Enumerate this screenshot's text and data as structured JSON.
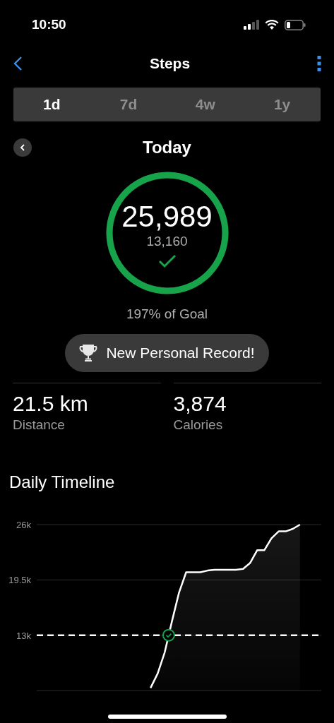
{
  "status_bar": {
    "time": "10:50"
  },
  "nav": {
    "title": "Steps"
  },
  "tabs": [
    {
      "label": "1d",
      "selected": true
    },
    {
      "label": "7d",
      "selected": false
    },
    {
      "label": "4w",
      "selected": false
    },
    {
      "label": "1y",
      "selected": false
    }
  ],
  "period": {
    "title": "Today"
  },
  "ring": {
    "steps": "25,989",
    "goal": "13,160",
    "level": 1,
    "goal_met": true,
    "caption": "197% of Goal"
  },
  "badge": {
    "label": "New Personal Record!"
  },
  "stats": [
    {
      "value": "21.5 km",
      "label": "Distance"
    },
    {
      "value": "3,874",
      "label": "Calories"
    }
  ],
  "timeline": {
    "title": "Daily Timeline",
    "chart_data": {
      "type": "area",
      "ylim": [
        6500,
        26000
      ],
      "yticks": [
        {
          "value": 26000,
          "label": "26k"
        },
        {
          "value": 19500,
          "label": "19.5k"
        },
        {
          "value": 13000,
          "label": "13k"
        }
      ],
      "categories": [
        null,
        null,
        null,
        null,
        null,
        null,
        null,
        null,
        null,
        null,
        null,
        null,
        null,
        null,
        null,
        null,
        null,
        null,
        null,
        null,
        null,
        null,
        null,
        null,
        null,
        null,
        null,
        null,
        null,
        null,
        null,
        null,
        null,
        null,
        null,
        null,
        null,
        null,
        null,
        null,
        null
      ],
      "series": [
        {
          "color": "#ffffff",
          "values": [
            null,
            null,
            null,
            null,
            null,
            null,
            null,
            null,
            null,
            null,
            null,
            null,
            null,
            null,
            null,
            null,
            6800,
            8500,
            11000,
            14600,
            18000,
            20400,
            20400,
            20400,
            20600,
            20700,
            20700,
            20700,
            20700,
            20800,
            21500,
            23000,
            23000,
            24400,
            25200,
            25200,
            25500,
            26000,
            null,
            null,
            null
          ]
        }
      ],
      "ref_lines": [
        {
          "axis": "y",
          "value": 13000
        }
      ]
    }
  }
}
